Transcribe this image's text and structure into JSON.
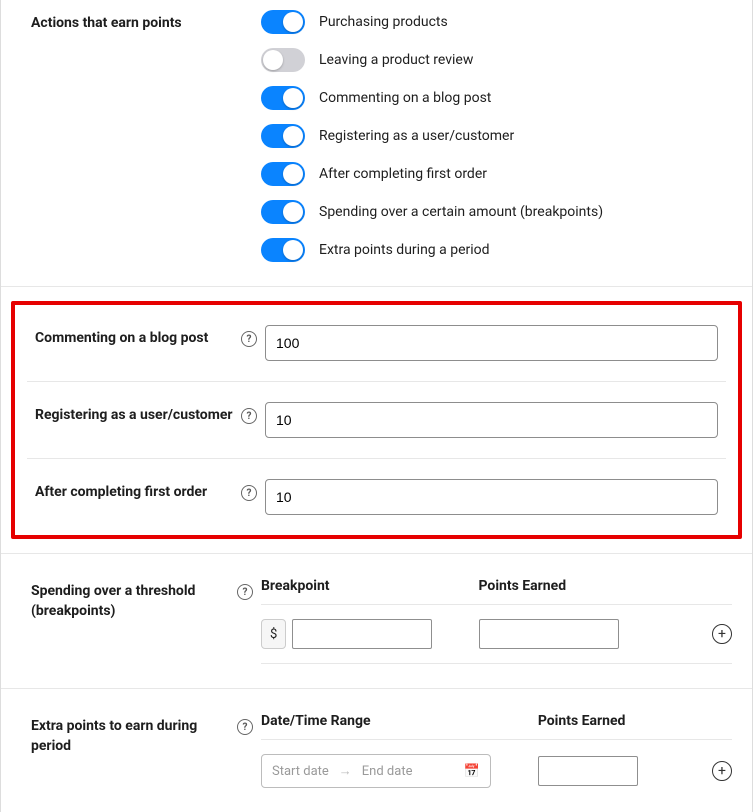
{
  "actions_section": {
    "label": "Actions that earn points",
    "toggles": [
      {
        "label": "Purchasing products",
        "on": true
      },
      {
        "label": "Leaving a product review",
        "on": false
      },
      {
        "label": "Commenting on a blog post",
        "on": true
      },
      {
        "label": "Registering as a user/customer",
        "on": true
      },
      {
        "label": "After completing first order",
        "on": true
      },
      {
        "label": "Spending over a certain amount (breakpoints)",
        "on": true
      },
      {
        "label": "Extra points during a period",
        "on": true
      }
    ]
  },
  "point_rows": [
    {
      "label": "Commenting on a blog post",
      "value": "100"
    },
    {
      "label": "Registering as a user/customer",
      "value": "10"
    },
    {
      "label": "After completing first order",
      "value": "10"
    }
  ],
  "threshold": {
    "label": "Spending over a threshold (breakpoints)",
    "col_breakpoint": "Breakpoint",
    "col_points": "Points Earned",
    "currency": "$",
    "breakpoint_value": "",
    "points_value": ""
  },
  "extra": {
    "label": "Extra points to earn during period",
    "col_range": "Date/Time Range",
    "col_points": "Points Earned",
    "start_placeholder": "Start date",
    "end_placeholder": "End date",
    "points_value": ""
  }
}
